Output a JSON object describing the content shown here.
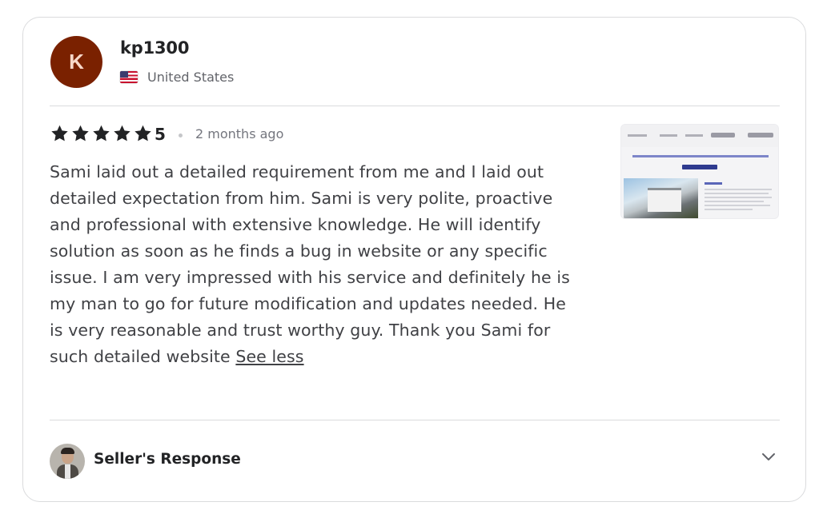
{
  "reviewer": {
    "avatar_initial": "K",
    "avatar_color": "#7a2100",
    "username": "kp1300",
    "country": "United States",
    "flag_icon": "us-flag-icon"
  },
  "rating": {
    "stars": 5,
    "value": "5",
    "time_ago": "2 months ago",
    "star_color": "#222325"
  },
  "review": {
    "text": "Sami laid out a detailed requirement from me and I laid out detailed expectation from him. Sami is very polite, proactive and professional with extensive knowledge. He will identify solution as soon as he finds a bug in website or any specific issue. I am very impressed with his service and definitely he is my man to go for future modification and updates needed. He is very reasonable and trust worthy guy. Thank you Sami for such detailed website",
    "see_less_label": "See less"
  },
  "seller_response": {
    "label": "Seller's Response",
    "toggle_icon": "chevron-down-icon"
  }
}
